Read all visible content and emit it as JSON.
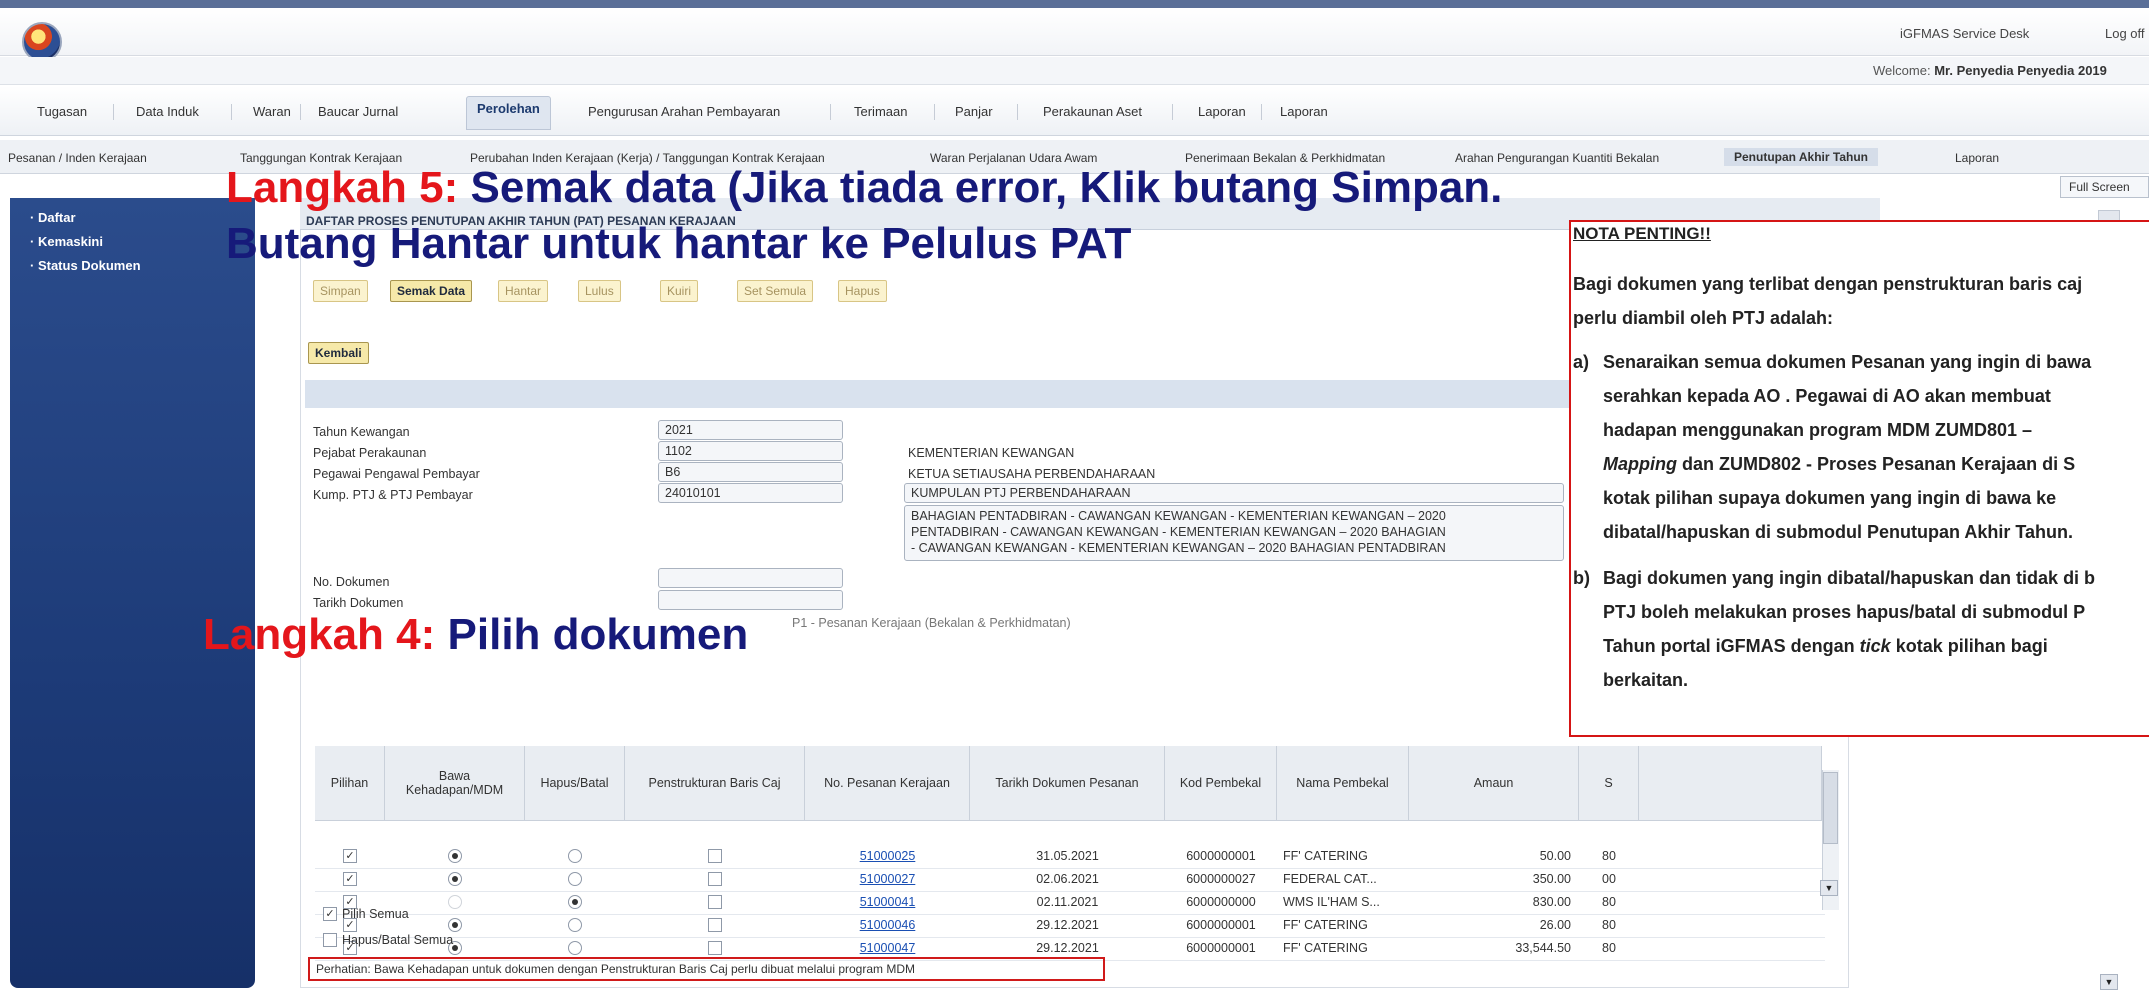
{
  "header": {
    "service_desk": "iGFMAS Service Desk",
    "log_off": "Log off",
    "welcome_prefix": "Welcome:",
    "welcome_user": "Mr. Penyedia Penyedia 2019"
  },
  "main_nav": [
    "Tugasan",
    "Data Induk",
    "Waran",
    "Baucar Jurnal",
    "Perolehan",
    "Pengurusan Arahan Pembayaran",
    "Terimaan",
    "Panjar",
    "Perakaunan Aset",
    "Laporan",
    "Laporan"
  ],
  "sub_nav": [
    "Pesanan / Inden Kerajaan",
    "Tanggungan Kontrak Kerajaan",
    "Perubahan Inden Kerajaan (Kerja) / Tanggungan Kontrak Kerajaan",
    "Waran Perjalanan Udara Awam",
    "Penerimaan Bekalan & Perkhidmatan",
    "Arahan Pengurangan Kuantiti Bekalan",
    "Penutupan Akhir Tahun",
    "Laporan"
  ],
  "full_screen": "Full Screen",
  "sidebar": [
    "Daftar",
    "Kemaskini",
    "Status Dokumen"
  ],
  "panel_title": "DAFTAR PROSES PENUTUPAN AKHIR TAHUN (PAT) PESANAN KERAJAAN",
  "buttons": {
    "simpan": "Simpan",
    "semak_data": "Semak Data",
    "hantar": "Hantar",
    "lulus": "Lulus",
    "kuiri": "Kuiri",
    "set_semula": "Set Semula",
    "hapus": "Hapus",
    "kembali": "Kembali"
  },
  "form": {
    "tahun_label": "Tahun Kewangan",
    "tahun_value": "2021",
    "pejabat_label": "Pejabat Perakaunan",
    "pejabat_value": "1102",
    "pejabat_desc": "KEMENTERIAN KEWANGAN",
    "pegawai_label": "Pegawai Pengawal Pembayar",
    "pegawai_value": "B6",
    "pegawai_desc": "KETUA SETIAUSAHA PERBENDAHARAAN",
    "kump_label": "Kump. PTJ & PTJ Pembayar",
    "kump_value": "24010101",
    "kump_desc": "KUMPULAN PTJ PERBENDAHARAAN",
    "kump_desc2_line1": "BAHAGIAN PENTADBIRAN - CAWANGAN KEWANGAN - KEMENTERIAN KEWANGAN – 2020",
    "kump_desc2_line2": "PENTADBIRAN - CAWANGAN KEWANGAN - KEMENTERIAN KEWANGAN – 2020 BAHAGIAN",
    "kump_desc2_line3": "- CAWANGAN KEWANGAN - KEMENTERIAN KEWANGAN – 2020 BAHAGIAN PENTADBIRAN",
    "no_dokumen_label": "No. Dokumen",
    "tarikh_dokumen_label": "Tarikh Dokumen",
    "jenis_value": "P1 - Pesanan Kerajaan (Bekalan & Perkhidmatan)"
  },
  "table": {
    "headers": [
      "Pilihan",
      "Bawa Kehadapan/MDM",
      "Hapus/Batal",
      "Penstrukturan Baris Caj",
      "No. Pesanan Kerajaan",
      "Tarikh Dokumen Pesanan",
      "Kod Pembekal",
      "Nama Pembekal",
      "Amaun",
      "S"
    ],
    "rows": [
      {
        "no": "51000025",
        "tarikh": "31.05.2021",
        "kod": "6000000001",
        "nama": "FF' CATERING",
        "amaun": "50.00",
        "s": "80",
        "bawa": true,
        "hapus": false
      },
      {
        "no": "51000027",
        "tarikh": "02.06.2021",
        "kod": "6000000027",
        "nama": "FEDERAL CAT...",
        "amaun": "350.00",
        "s": "00",
        "bawa": true,
        "hapus": false
      },
      {
        "no": "51000041",
        "tarikh": "02.11.2021",
        "kod": "6000000000",
        "nama": "WMS IL'HAM S...",
        "amaun": "830.00",
        "s": "80",
        "bawa": false,
        "hapus": true
      },
      {
        "no": "51000046",
        "tarikh": "29.12.2021",
        "kod": "6000000001",
        "nama": "FF' CATERING",
        "amaun": "26.00",
        "s": "80",
        "bawa": true,
        "hapus": false
      },
      {
        "no": "51000047",
        "tarikh": "29.12.2021",
        "kod": "6000000001",
        "nama": "FF' CATERING",
        "amaun": "33,544.50",
        "s": "80",
        "bawa": true,
        "hapus": false
      }
    ]
  },
  "pilih_semua": "Pilih Semua",
  "hapus_batal_semua": "Hapus/Batal Semua",
  "notice": "Perhatian: Bawa Kehadapan untuk dokumen dengan Penstrukturan Baris Caj perlu dibuat melalui program MDM",
  "callouts": {
    "step5_prefix": "Langkah 5:",
    "step5_text": "Semak data (Jika tiada error, Klik butang Simpan.",
    "step5_line2": "Butang Hantar untuk hantar ke Pelulus PAT",
    "step4_prefix": "Langkah 4:",
    "step4_text": "Pilih dokumen"
  },
  "nota": {
    "title": "NOTA PENTING!!",
    "intro1": "Bagi dokumen yang terlibat dengan penstrukturan baris caj",
    "intro2": "perlu diambil oleh PTJ adalah:",
    "a_label": "a)",
    "a1": "Senaraikan semua dokumen Pesanan yang ingin di bawa",
    "a2": "serahkan kepada AO . Pegawai di AO akan membuat",
    "a3": "hadapan menggunakan program MDM ZUMD801 –",
    "a4_italic": "Mapping",
    "a4_rest": " dan ZUMD802 - Proses Pesanan Kerajaan di S",
    "a5": "kotak pilihan supaya dokumen yang ingin di bawa ke",
    "a6": "dibatal/hapuskan di submodul Penutupan Akhir Tahun.",
    "b_label": "b)",
    "b1": "Bagi dokumen yang ingin dibatal/hapuskan dan tidak di b",
    "b2": "PTJ boleh melakukan proses hapus/batal di submodul P",
    "b3_pre": "Tahun portal iGFMAS dengan ",
    "b3_italic": "tick",
    "b3_post": " kotak pilihan bagi",
    "b4": "berkaitan."
  }
}
